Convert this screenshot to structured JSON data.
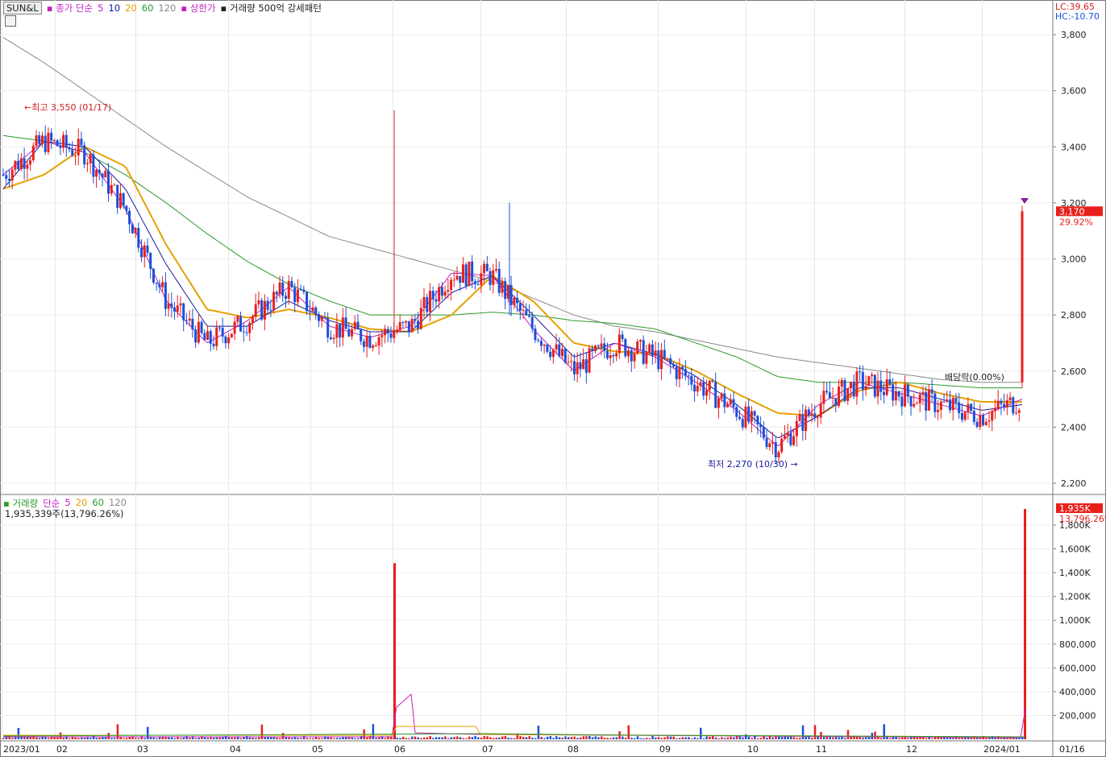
{
  "header": {
    "symbol": "SUN&L",
    "ma_label": "종가 단순",
    "ma_periods": [
      "5",
      "10",
      "20",
      "60",
      "120"
    ],
    "limit_up": "상한가",
    "pattern": "거래량 500억 강세패턴"
  },
  "corner": {
    "lc": "LC:39.65",
    "hc": "HC:-10.70"
  },
  "price_axis": {
    "ticks": [
      "3,800",
      "3,600",
      "3,400",
      "3,200",
      "3,000",
      "2,800",
      "2,600",
      "2,400",
      "2,200"
    ],
    "min": 2200,
    "max": 3800
  },
  "volume_axis": {
    "ticks": [
      "1,800K",
      "1,600K",
      "1,400K",
      "1,200K",
      "1,000K",
      "800,000",
      "600,000",
      "400,000",
      "200,000"
    ],
    "max": 1800000
  },
  "x_axis": {
    "ticks": [
      "2023/01",
      "02",
      "03",
      "04",
      "05",
      "06",
      "07",
      "08",
      "09",
      "10",
      "11",
      "12",
      "2024/01",
      "01/16"
    ]
  },
  "annotations": {
    "high": "최고 3,550 (01/17)",
    "low": "최저 2,270 (10/30)",
    "dividend": "배당락(0.00%)"
  },
  "last": {
    "price": "3,170",
    "change": "29.92%",
    "volume": "1,935K",
    "volume_ratio": "13,796.26%"
  },
  "volume_legend": {
    "label": "거래량",
    "ma_label": "단순",
    "periods": [
      "5",
      "20",
      "60",
      "120"
    ]
  },
  "volume_info": "1,935,339주(13,796.26%)",
  "colors": {
    "up": "#e8201c",
    "down": "#1c4fd8",
    "ma5": "#c020c0",
    "ma10": "#1a1aa0",
    "ma20": "#e6a000",
    "ma60": "#2a9a2a",
    "ma120": "#888888"
  },
  "chart_data": {
    "type": "candlestick",
    "title": "SUN&L",
    "x_range": [
      "2023/01",
      "01/16"
    ],
    "y_range": [
      2200,
      3800
    ],
    "series": [
      {
        "name": "5",
        "values": [
          3300,
          3420,
          3380,
          3180,
          2850,
          2700,
          2780,
          2900,
          2760,
          2720,
          2760,
          2950,
          2940,
          2750,
          2600,
          2700,
          2650,
          2560,
          2460,
          2330,
          2480,
          2560,
          2520,
          2480,
          2440,
          2500
        ]
      },
      {
        "name": "10",
        "values": [
          3250,
          3420,
          3400,
          3250,
          2980,
          2760,
          2760,
          2850,
          2780,
          2740,
          2740,
          2880,
          2940,
          2800,
          2650,
          2700,
          2660,
          2580,
          2480,
          2360,
          2440,
          2540,
          2540,
          2500,
          2460,
          2480
        ]
      },
      {
        "name": "20",
        "values": [
          3250,
          3300,
          3400,
          3330,
          3050,
          2820,
          2790,
          2820,
          2790,
          2750,
          2740,
          2800,
          2940,
          2850,
          2700,
          2670,
          2660,
          2600,
          2520,
          2450,
          2440,
          2530,
          2560,
          2520,
          2490,
          2490
        ]
      },
      {
        "name": "60",
        "values": [
          3440,
          3420,
          3380,
          3300,
          3200,
          3090,
          2990,
          2910,
          2850,
          2800,
          2800,
          2800,
          2810,
          2800,
          2780,
          2770,
          2750,
          2700,
          2650,
          2580,
          2560,
          2560,
          2560,
          2550,
          2540,
          2540
        ]
      },
      {
        "name": "120",
        "values": [
          3790,
          3700,
          3600,
          3500,
          3400,
          3310,
          3220,
          3150,
          3080,
          3040,
          3000,
          2960,
          2920,
          2860,
          2800,
          2760,
          2740,
          2710,
          2680,
          2650,
          2630,
          2610,
          2590,
          2570,
          2560,
          2560
        ]
      }
    ],
    "last_close": 3170,
    "high": 3550,
    "low": 2270,
    "volume_last": 1935339,
    "volume_spike_06": 1480000
  }
}
